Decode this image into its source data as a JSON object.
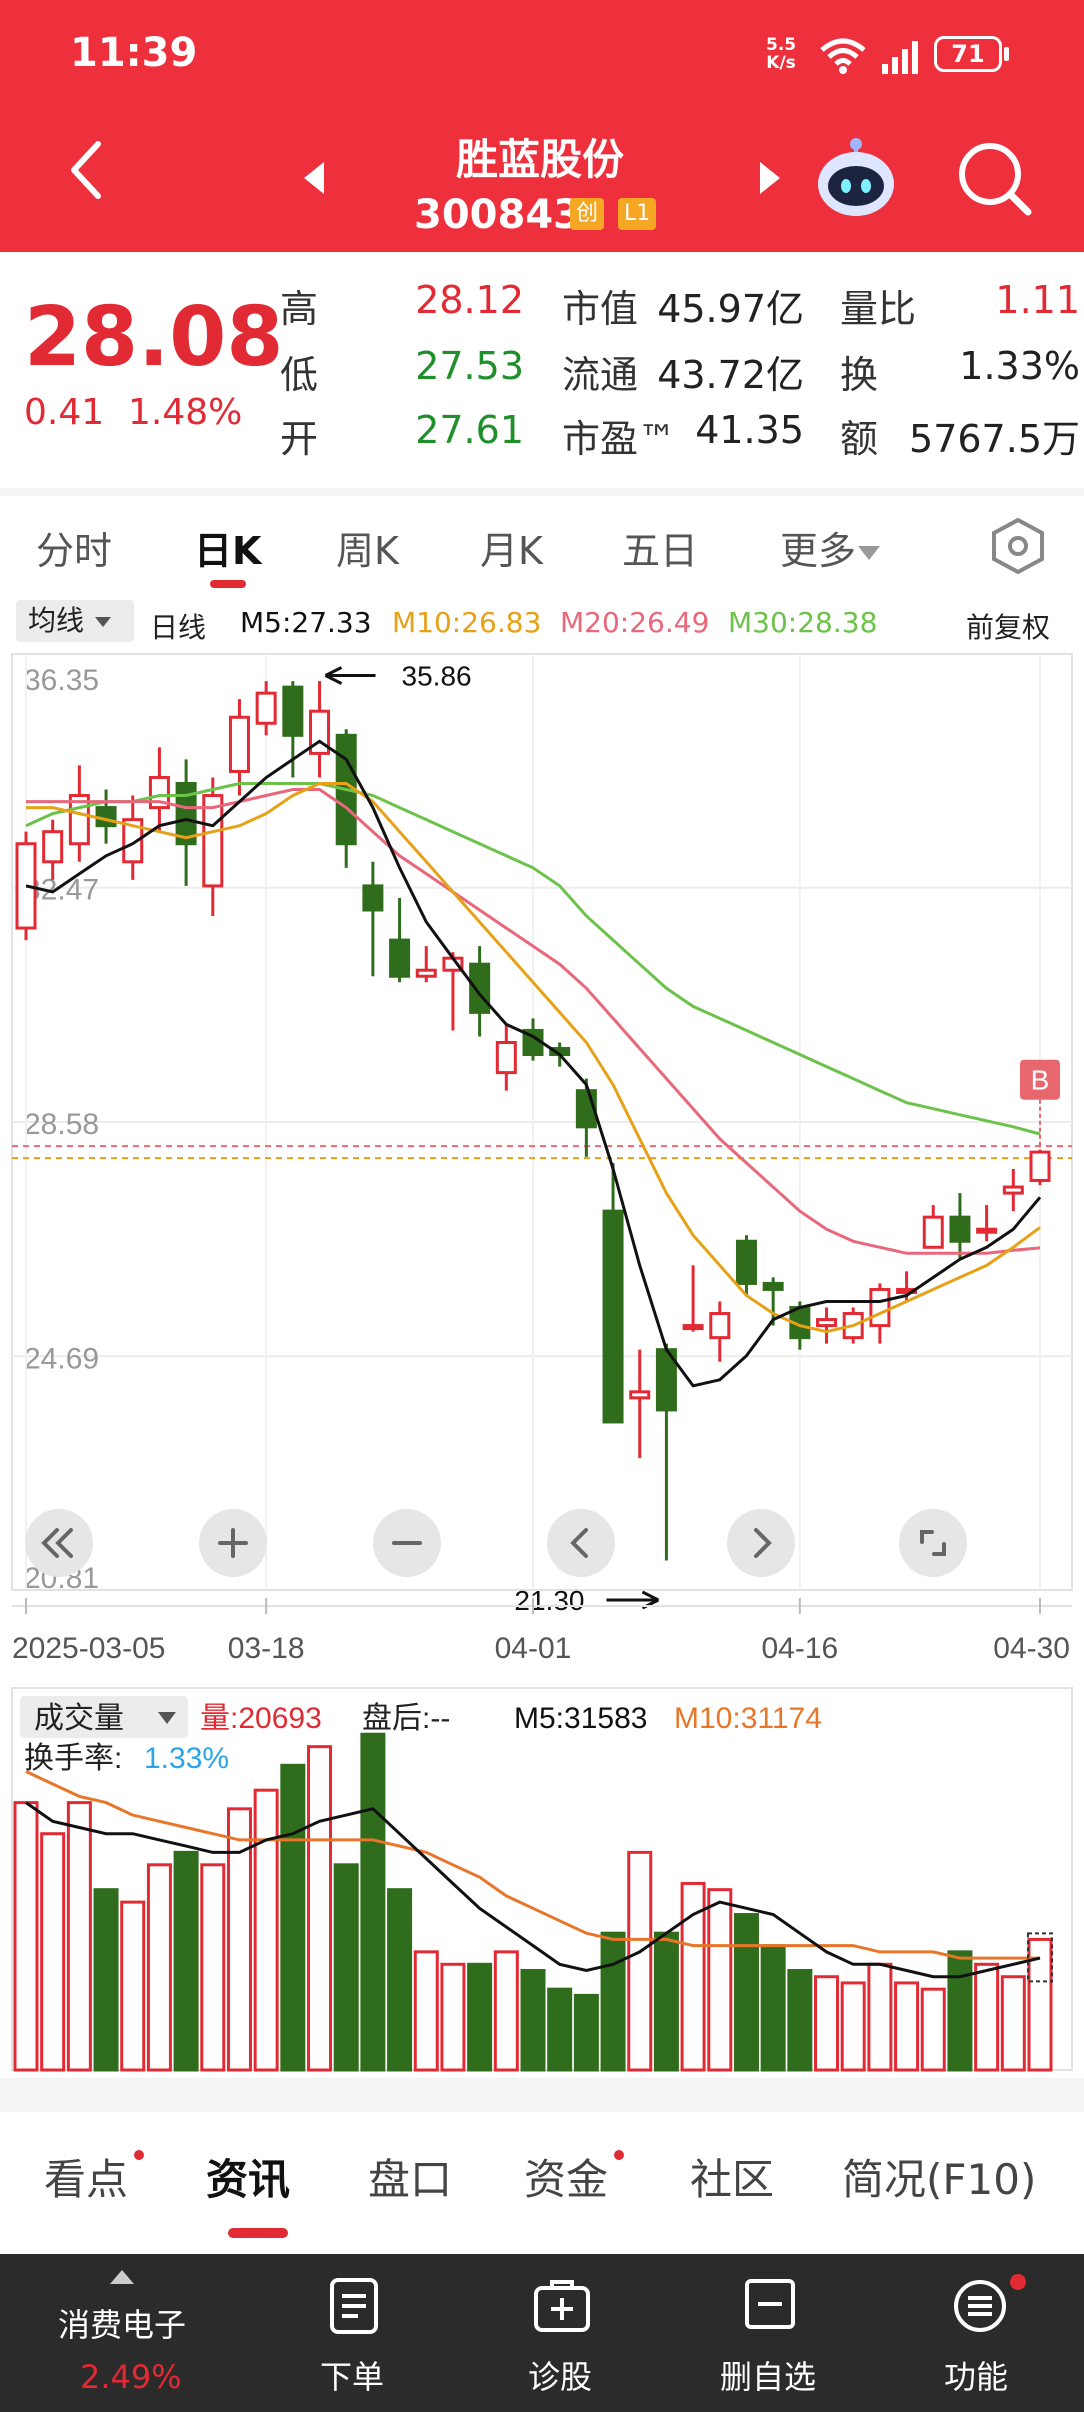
{
  "status": {
    "time": "11:39",
    "net_speed_top": "5.5",
    "net_speed_unit": "K/s",
    "battery": "71"
  },
  "header": {
    "name": "胜蓝股份",
    "code": "300843",
    "badge1": "创",
    "badge2": "L1"
  },
  "quote": {
    "price": "28.08",
    "change": "0.41",
    "change_pct": "1.48%",
    "high_label": "高",
    "high": "28.12",
    "low_label": "低",
    "low": "27.53",
    "open_label": "开",
    "open": "27.61",
    "mktcap_label": "市值",
    "mktcap": "45.97亿",
    "float_label": "流通",
    "float": "43.72亿",
    "pe_label": "市盈™",
    "pe": "41.35",
    "volratio_label": "量比",
    "volratio": "1.11",
    "turnover_label": "换",
    "turnover": "1.33%",
    "amount_label": "额",
    "amount": "5767.5万"
  },
  "tabs": [
    "分时",
    "日K",
    "周K",
    "月K",
    "五日",
    "更多"
  ],
  "ma": {
    "select": "均线",
    "type": "日线",
    "m5": "M5:27.33",
    "m10": "M10:26.83",
    "m20": "M20:26.49",
    "m30": "M30:28.38",
    "adjust": "前复权"
  },
  "colors": {
    "up": "#e12a33",
    "down": "#2f6d1c",
    "m5": "#111111",
    "m10": "#e6a117",
    "m20": "#e8677a",
    "m30": "#6cc24a"
  },
  "chart_data": {
    "type": "candlestick",
    "y_ticks": [
      "36.35",
      "32.47",
      "28.58",
      "24.69",
      "20.81"
    ],
    "ylim": [
      20.81,
      36.35
    ],
    "x_ticks": [
      "2025-03-05",
      "03-18",
      "04-01",
      "04-16",
      "04-30"
    ],
    "x_tick_index": [
      0,
      9,
      19,
      29,
      38
    ],
    "high_mark": "35.86",
    "low_mark": "21.30",
    "b_marker": "B",
    "candles": [
      [
        0,
        31.8,
        33.2,
        33.4,
        31.6
      ],
      [
        1,
        32.9,
        33.4,
        33.6,
        32.6
      ],
      [
        2,
        33.2,
        34.0,
        34.5,
        32.9
      ],
      [
        3,
        33.8,
        33.5,
        34.1,
        33.2
      ],
      [
        4,
        32.9,
        33.6,
        34.0,
        32.6
      ],
      [
        5,
        33.8,
        34.3,
        34.8,
        33.4
      ],
      [
        6,
        34.2,
        33.2,
        34.6,
        32.5
      ],
      [
        7,
        32.5,
        34.0,
        34.3,
        32.0
      ],
      [
        8,
        34.4,
        35.3,
        35.6,
        34.0
      ],
      [
        9,
        35.2,
        35.7,
        35.9,
        35.0
      ],
      [
        10,
        35.8,
        35.0,
        35.9,
        34.3
      ],
      [
        11,
        34.7,
        35.4,
        35.9,
        34.3
      ],
      [
        12,
        35.0,
        33.2,
        35.1,
        32.8
      ],
      [
        13,
        32.5,
        32.1,
        32.9,
        31.0
      ],
      [
        14,
        31.6,
        31.0,
        32.3,
        30.9
      ],
      [
        15,
        31.0,
        31.1,
        31.5,
        30.9
      ],
      [
        16,
        31.1,
        31.3,
        31.4,
        30.1
      ],
      [
        17,
        31.2,
        30.4,
        31.5,
        30.0
      ],
      [
        18,
        29.4,
        29.9,
        30.2,
        29.1
      ],
      [
        19,
        30.1,
        29.7,
        30.3,
        29.6
      ],
      [
        20,
        29.8,
        29.7,
        29.9,
        29.5
      ],
      [
        21,
        29.1,
        28.5,
        29.3,
        28.0
      ],
      [
        22,
        27.1,
        23.6,
        27.9,
        23.6
      ],
      [
        23,
        24.0,
        24.1,
        24.8,
        23.0
      ],
      [
        24,
        24.8,
        23.8,
        24.9,
        21.3
      ],
      [
        25,
        25.2,
        25.2,
        26.2,
        25.1
      ],
      [
        26,
        25.0,
        25.4,
        25.6,
        24.6
      ],
      [
        27,
        26.6,
        25.9,
        26.7,
        25.7
      ],
      [
        28,
        25.9,
        25.8,
        26.0,
        25.2
      ],
      [
        29,
        25.5,
        25.0,
        25.6,
        24.8
      ],
      [
        30,
        25.2,
        25.3,
        25.5,
        24.9
      ],
      [
        31,
        25.0,
        25.4,
        25.5,
        24.9
      ],
      [
        32,
        25.2,
        25.8,
        25.9,
        24.9
      ],
      [
        33,
        25.8,
        25.8,
        26.1,
        25.6
      ],
      [
        34,
        26.5,
        27.0,
        27.2,
        26.5
      ],
      [
        35,
        27.0,
        26.6,
        27.4,
        26.3
      ],
      [
        36,
        26.8,
        26.8,
        27.2,
        26.6
      ],
      [
        37,
        27.4,
        27.5,
        27.8,
        27.1
      ],
      [
        38,
        27.61,
        28.08,
        28.12,
        27.53
      ]
    ],
    "ma5": [
      32.5,
      32.4,
      32.7,
      33.0,
      33.2,
      33.5,
      33.6,
      33.5,
      33.9,
      34.3,
      34.6,
      34.9,
      34.6,
      33.8,
      32.8,
      31.9,
      31.3,
      30.7,
      30.2,
      30.0,
      29.7,
      29.2,
      27.8,
      26.2,
      24.8,
      24.2,
      24.3,
      24.7,
      25.3,
      25.5,
      25.6,
      25.6,
      25.6,
      25.7,
      26.0,
      26.3,
      26.5,
      26.8,
      27.33
    ],
    "ma10": [
      33.8,
      33.8,
      33.7,
      33.6,
      33.5,
      33.4,
      33.3,
      33.4,
      33.5,
      33.7,
      34.0,
      34.2,
      34.2,
      33.9,
      33.4,
      32.9,
      32.4,
      31.9,
      31.4,
      30.9,
      30.4,
      29.9,
      29.2,
      28.3,
      27.4,
      26.7,
      26.2,
      25.7,
      25.4,
      25.2,
      25.1,
      25.2,
      25.4,
      25.6,
      25.8,
      26.0,
      26.2,
      26.5,
      26.83
    ],
    "ma20": [
      33.9,
      33.9,
      33.9,
      33.9,
      33.9,
      33.9,
      33.8,
      33.8,
      33.9,
      34.0,
      34.1,
      34.1,
      33.8,
      33.4,
      33.0,
      32.7,
      32.4,
      32.1,
      31.8,
      31.5,
      31.2,
      30.8,
      30.3,
      29.8,
      29.3,
      28.8,
      28.3,
      27.9,
      27.5,
      27.1,
      26.8,
      26.6,
      26.5,
      26.4,
      26.4,
      26.4,
      26.4,
      26.45,
      26.49
    ],
    "ma30": [
      33.5,
      33.7,
      33.8,
      33.9,
      33.9,
      34.0,
      34.0,
      34.1,
      34.2,
      34.2,
      34.2,
      34.2,
      34.1,
      34.0,
      33.8,
      33.6,
      33.4,
      33.2,
      33.0,
      32.8,
      32.5,
      32.0,
      31.6,
      31.2,
      30.8,
      30.5,
      30.3,
      30.1,
      29.9,
      29.7,
      29.5,
      29.3,
      29.1,
      28.9,
      28.8,
      28.7,
      28.6,
      28.5,
      28.38
    ],
    "volume": {
      "title": "成交量",
      "vol": "量:20693",
      "after": "盘后:--",
      "m5": "M5:31583",
      "m10": "M10:31174",
      "turnover_label": "换手率:",
      "turnover": "1.33%",
      "bars": [
        [
          0,
          43
        ],
        [
          1,
          38
        ],
        [
          2,
          43
        ],
        [
          3,
          29
        ],
        [
          4,
          27
        ],
        [
          5,
          33
        ],
        [
          6,
          35
        ],
        [
          7,
          33
        ],
        [
          8,
          42
        ],
        [
          9,
          45
        ],
        [
          10,
          49
        ],
        [
          11,
          52
        ],
        [
          12,
          33
        ],
        [
          13,
          54
        ],
        [
          14,
          29
        ],
        [
          15,
          19
        ],
        [
          16,
          17
        ],
        [
          17,
          17
        ],
        [
          18,
          19
        ],
        [
          19,
          16
        ],
        [
          20,
          13
        ],
        [
          21,
          12
        ],
        [
          22,
          22
        ],
        [
          23,
          35
        ],
        [
          24,
          22
        ],
        [
          25,
          30
        ],
        [
          26,
          29
        ],
        [
          27,
          25
        ],
        [
          28,
          20
        ],
        [
          29,
          16
        ],
        [
          30,
          15
        ],
        [
          31,
          14
        ],
        [
          32,
          17
        ],
        [
          33,
          14
        ],
        [
          34,
          13
        ],
        [
          35,
          19
        ],
        [
          36,
          17
        ],
        [
          37,
          15
        ],
        [
          38,
          21
        ]
      ],
      "vol_ma5": [
        43,
        40,
        39,
        38,
        38,
        37,
        36,
        35,
        35,
        37,
        38,
        40,
        41,
        42,
        38,
        34,
        30,
        26,
        23,
        20,
        17,
        16,
        17,
        19,
        22,
        25,
        27,
        26,
        25,
        22,
        19,
        17,
        17,
        16,
        15,
        15,
        16,
        17,
        18
      ],
      "vol_ma10": [
        48,
        46,
        44,
        43,
        41,
        40,
        39,
        38,
        37,
        37,
        37,
        37,
        37,
        37,
        36,
        35,
        33,
        31,
        28,
        26,
        24,
        22,
        21,
        21,
        21,
        20,
        20,
        20,
        20,
        20,
        20,
        20,
        19,
        19,
        19,
        18,
        18,
        18,
        18
      ],
      "ylim": [
        0,
        55
      ]
    }
  },
  "bottom_tabs": [
    "看点",
    "资讯",
    "盘口",
    "资金",
    "社区",
    "简况(F10)"
  ],
  "dock": {
    "sector_name": "消费电子",
    "sector_pct": "2.49%",
    "order": "下单",
    "diagnose": "诊股",
    "remove": "删自选",
    "func": "功能"
  }
}
